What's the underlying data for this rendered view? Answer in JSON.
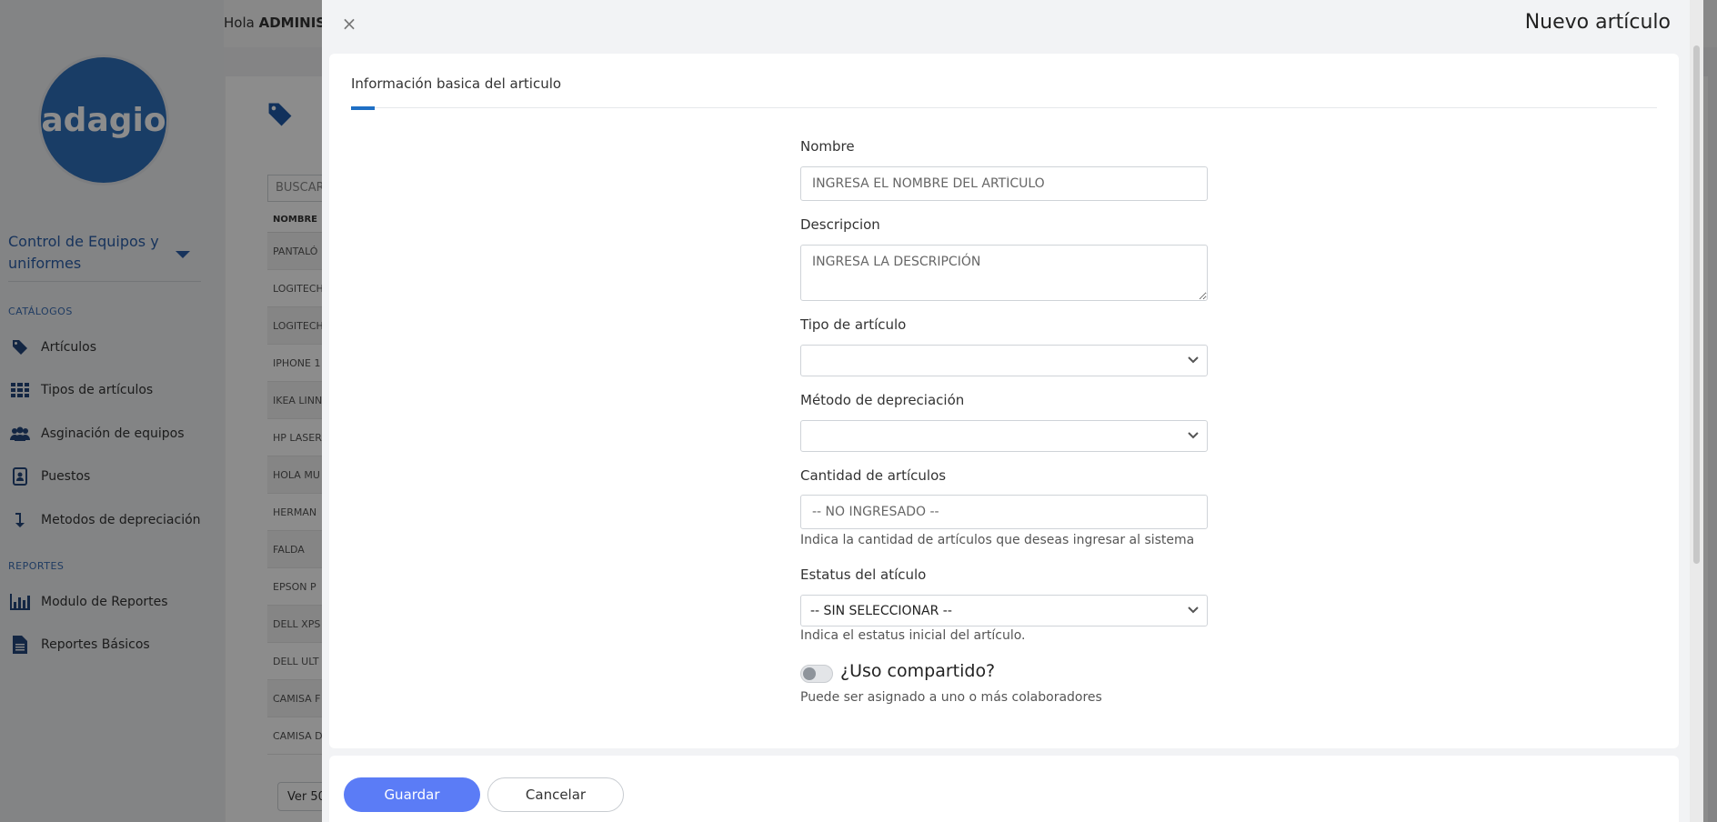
{
  "background": {
    "header": {
      "greeting": "Hola",
      "user": "ADMINIST"
    },
    "logo_text": "adagio",
    "module": "Control de Equipos y uniformes",
    "sections": {
      "catalogs": "CATÁLOGOS",
      "reports": "REPORTES"
    },
    "nav_catalogs": [
      {
        "label": "Artículos",
        "icon": "tag-icon"
      },
      {
        "label": "Tipos de artículos",
        "icon": "grid-icon"
      },
      {
        "label": "Asginación de equipos",
        "icon": "users-icon"
      },
      {
        "label": "Puestos",
        "icon": "badge-icon"
      },
      {
        "label": "Metodos de depreciación",
        "icon": "arrow-down-icon"
      }
    ],
    "nav_reports": [
      {
        "label": "Modulo de Reportes",
        "icon": "bar-chart-icon"
      },
      {
        "label": "Reportes Básicos",
        "icon": "document-icon"
      }
    ],
    "search_placeholder": "BUSCAR",
    "table": {
      "header": "NOMBRE",
      "rows": [
        "PANTALÓ",
        "LOGITECH",
        "LOGITECH",
        "IPHONE 1",
        "IKEA LINN",
        "HP LASER",
        "HOLA MU",
        "HERMAN",
        "FALDA",
        "EPSON P",
        "DELL XPS",
        "DELL ULT",
        "CAMISA F",
        "CAMISA D"
      ]
    },
    "page_size": "Ver 50"
  },
  "modal": {
    "title": "Nuevo artículo",
    "close_icon": "×",
    "tab": "Información basica del articulo",
    "fields": {
      "name_label": "Nombre",
      "name_placeholder": "INGRESA EL NOMBRE DEL ARTÍCULO",
      "description_label": "Descripcion",
      "description_placeholder": "INGRESA LA DESCRIPCIÓN",
      "type_label": "Tipo de artículo",
      "type_value": "",
      "depreciation_label": "Método de depreciación",
      "depreciation_value": "",
      "quantity_label": "Cantidad de artículos",
      "quantity_placeholder": "-- NO INGRESADO --",
      "quantity_help": "Indica la cantidad de artículos que deseas ingresar al sistema",
      "status_label": "Estatus del atículo",
      "status_value": "-- SIN SELECCIONAR --",
      "status_help": "Indica el estatus inicial del artículo.",
      "shared_label": "¿Uso compartido?",
      "shared_help": "Puede ser asignado a uno o más colaboradores",
      "shared_on": false
    },
    "buttons": {
      "save": "Guardar",
      "cancel": "Cancelar"
    }
  },
  "colors": {
    "primary_button": "#5b7cf6",
    "tab_accent": "#1f6fc5",
    "logo": "#2f6fba"
  }
}
